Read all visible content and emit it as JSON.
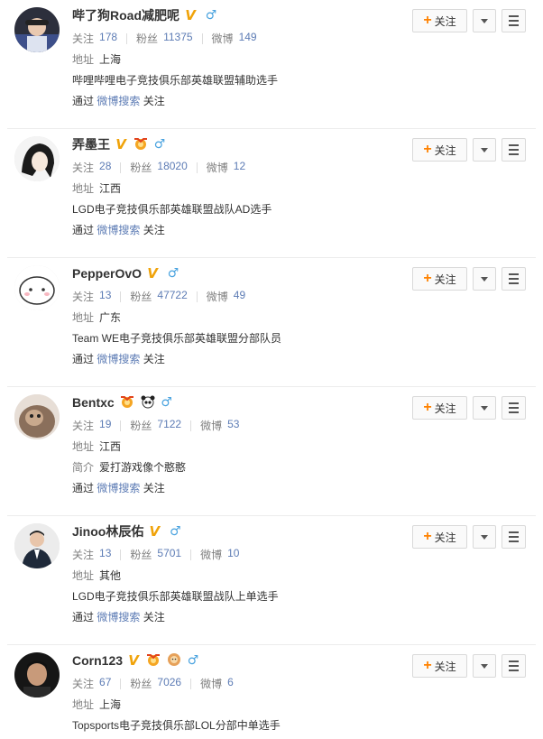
{
  "labels": {
    "follow": "关注",
    "followers": "粉丝",
    "weibo": "微博",
    "address": "地址",
    "intro": "简介",
    "via_prefix": "通过",
    "via_link": "微博搜索",
    "via_suffix": "关注"
  },
  "colors": {
    "accent_orange": "#ff8200",
    "link_blue": "#5d7cb5",
    "verified_gold": "#f0a30a",
    "male_blue": "#4aa3df"
  },
  "users": [
    {
      "name": "哔了狗Road减肥呢",
      "verified": "V",
      "gender": "♂",
      "medals": [],
      "following": "178",
      "followers": "11375",
      "posts": "149",
      "address": "上海",
      "desc_label": "",
      "desc": "哔哩哔哩电子竞技俱乐部英雄联盟辅助选手",
      "avatar_icon": "gamer-avatar-icon"
    },
    {
      "name": "弄墨王",
      "verified": "V",
      "gender": "♂",
      "medals": [
        "medal-icon"
      ],
      "following": "28",
      "followers": "18020",
      "posts": "12",
      "address": "江西",
      "desc_label": "",
      "desc": "LGD电子竞技俱乐部英雄联盟战队AD选手",
      "avatar_icon": "anime-avatar-icon"
    },
    {
      "name": "PepperOvO",
      "verified": "V",
      "gender": "♂",
      "medals": [],
      "following": "13",
      "followers": "47722",
      "posts": "49",
      "address": "广东",
      "desc_label": "",
      "desc": "Team WE电子竞技俱乐部英雄联盟分部队员",
      "avatar_icon": "cartoon-avatar-icon"
    },
    {
      "name": "Bentxc",
      "verified": "",
      "gender": "♂",
      "medals": [
        "medal-icon",
        "panda-icon"
      ],
      "following": "19",
      "followers": "7122",
      "posts": "53",
      "address": "江西",
      "desc_label": "简介",
      "desc": "爱打游戏像个憨憨",
      "avatar_icon": "cat-avatar-icon"
    },
    {
      "name": "Jinoo林辰佑",
      "verified": "V",
      "gender": "♂",
      "medals": [],
      "following": "13",
      "followers": "5701",
      "posts": "10",
      "address": "其他",
      "desc_label": "",
      "desc": "LGD电子竞技俱乐部英雄联盟战队上单选手",
      "avatar_icon": "suit-avatar-icon"
    },
    {
      "name": "Corn123",
      "verified": "V",
      "gender": "♂",
      "medals": [
        "medal-icon",
        "lion-icon"
      ],
      "following": "67",
      "followers": "7026",
      "posts": "6",
      "address": "上海",
      "desc_label": "",
      "desc": "Topsports电子竞技俱乐部LOL分部中单选手",
      "avatar_icon": "portrait-avatar-icon"
    }
  ]
}
